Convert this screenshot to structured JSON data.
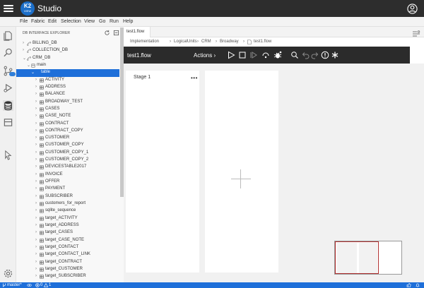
{
  "app": {
    "logo_text": "K2",
    "logo_subtext": "VIEW",
    "title": "Studio"
  },
  "menu": [
    "File",
    "Fabric",
    "Edit",
    "Selection",
    "View",
    "Go",
    "Run",
    "Help"
  ],
  "explorer": {
    "title": "DB INTERFACE EXPLORER",
    "nodes": [
      {
        "label": "BILLING_DB",
        "level": 0,
        "expanded": false
      },
      {
        "label": "COLLECTION_DB",
        "level": 0,
        "expanded": false
      },
      {
        "label": "CRM_DB",
        "level": 0,
        "expanded": true
      },
      {
        "label": "main",
        "level": 1,
        "expanded": true
      },
      {
        "label": "table",
        "level": 2,
        "expanded": true,
        "selected": true
      },
      {
        "label": "ACTIVITY",
        "level": 3
      },
      {
        "label": "ADDRESS",
        "level": 3
      },
      {
        "label": "BALANCE",
        "level": 3
      },
      {
        "label": "BROADWAY_TEST",
        "level": 3
      },
      {
        "label": "CASES",
        "level": 3
      },
      {
        "label": "CASE_NOTE",
        "level": 3
      },
      {
        "label": "CONTRACT",
        "level": 3
      },
      {
        "label": "CONTRACT_COPY",
        "level": 3
      },
      {
        "label": "CUSTOMER",
        "level": 3
      },
      {
        "label": "CUSTOMER_COPY",
        "level": 3
      },
      {
        "label": "CUSTOMER_COPY_1",
        "level": 3
      },
      {
        "label": "CUSTOMER_COPY_2",
        "level": 3
      },
      {
        "label": "DEVICESTABLE2017",
        "level": 3
      },
      {
        "label": "INVOICE",
        "level": 3
      },
      {
        "label": "OFFER",
        "level": 3
      },
      {
        "label": "PAYMENT",
        "level": 3
      },
      {
        "label": "SUBSCRIBER",
        "level": 3
      },
      {
        "label": "customers_for_report",
        "level": 3
      },
      {
        "label": "sqlite_sequence",
        "level": 3
      },
      {
        "label": "target_ACTIVITY",
        "level": 3
      },
      {
        "label": "target_ADDRESS",
        "level": 3
      },
      {
        "label": "target_CASES",
        "level": 3
      },
      {
        "label": "target_CASE_NOTE",
        "level": 3
      },
      {
        "label": "target_CONTACT",
        "level": 3
      },
      {
        "label": "target_CONTACT_LINK",
        "level": 3
      },
      {
        "label": "target_CONTRACT",
        "level": 3
      },
      {
        "label": "target_CUSTOMER",
        "level": 3
      },
      {
        "label": "target_SUBSCRIBER",
        "level": 3
      }
    ]
  },
  "tab": {
    "label": "test1.flow"
  },
  "breadcrumb": [
    "Implementation",
    "LogicalUnits",
    "CRM",
    "Broadway",
    "test1.flow"
  ],
  "flow": {
    "title": "test1.flow",
    "actions_label": "Actions"
  },
  "stage": {
    "title": "Stage 1",
    "menu": "•••"
  },
  "status": {
    "branch": "master*",
    "errors": "0",
    "warnings": "1"
  },
  "colors": {
    "accent": "#1e6fd9",
    "titlebar": "#2d2d2d",
    "toolbar": "#2b2b2b",
    "selection": "#1e6fd9"
  }
}
